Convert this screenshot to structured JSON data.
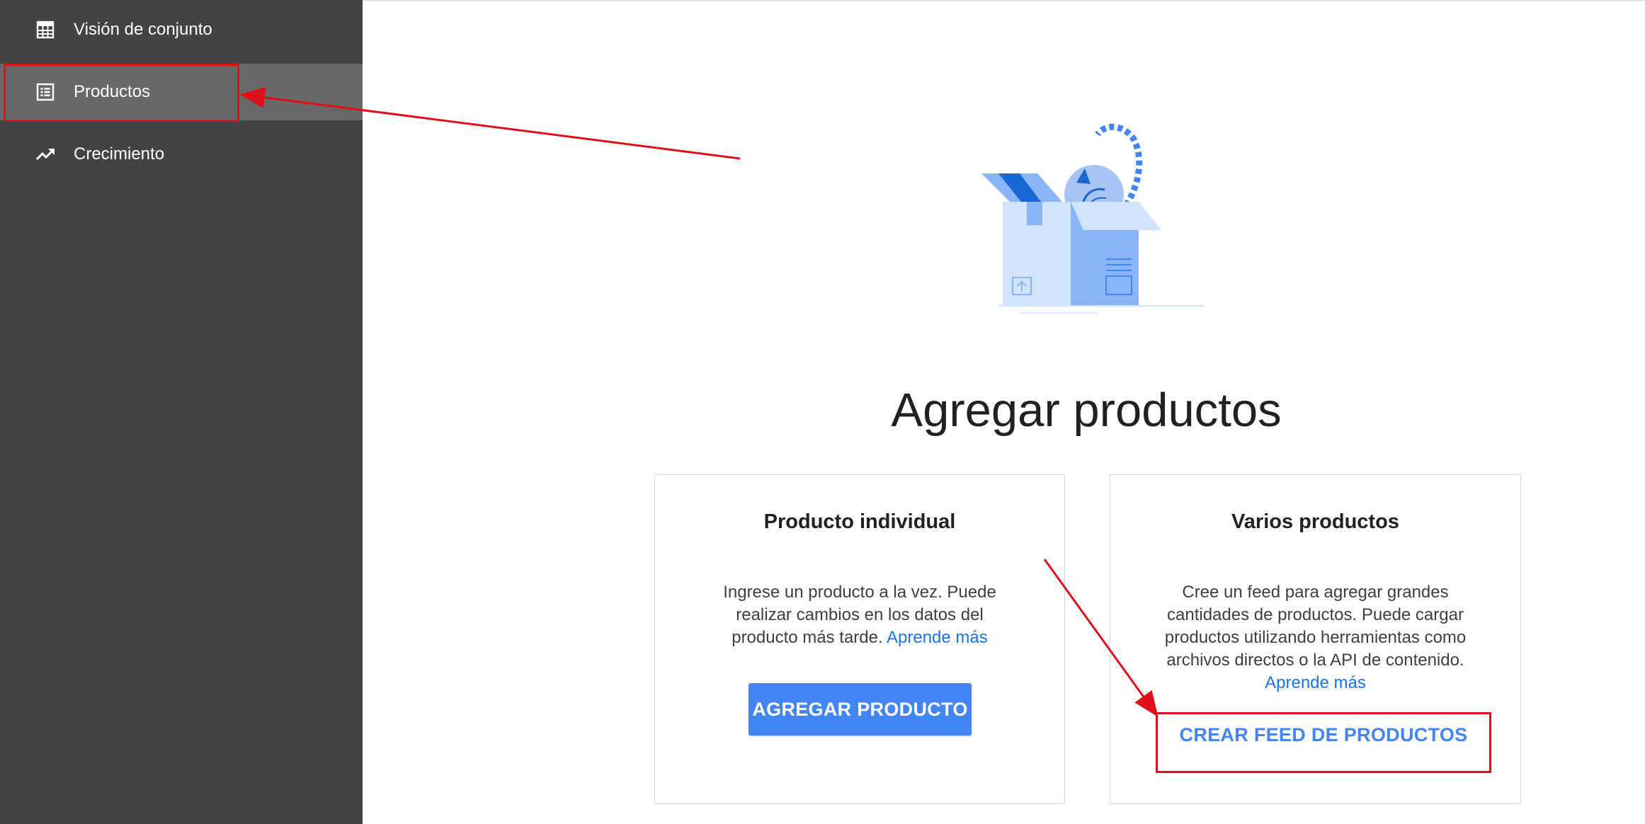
{
  "sidebar": {
    "items": [
      {
        "label": "Visión de conjunto",
        "icon": "calculator-grid-icon",
        "active": false
      },
      {
        "label": "Productos",
        "icon": "list-alt-icon",
        "active": true
      },
      {
        "label": "Crecimiento",
        "icon": "trending-up-icon",
        "active": false
      }
    ]
  },
  "main": {
    "title": "Agregar productos",
    "cards": {
      "individual": {
        "title": "Producto individual",
        "description": "Ingrese un producto a la vez. Puede realizar cambios en los datos del producto más tarde.",
        "link": "Aprende más",
        "button": "AGREGAR PRODUCTO"
      },
      "multiple": {
        "title": "Varios productos",
        "description": "Cree un feed para agregar grandes cantidades de productos. Puede cargar productos utilizando herramientas como archivos directos o la API de contenido.",
        "link": "Aprende más",
        "button": "CREAR FEED DE PRODUCTOS"
      }
    }
  },
  "colors": {
    "sidebar_bg": "#434343",
    "sidebar_active": "#686868",
    "primary": "#4285f4",
    "link": "#1a73e8",
    "annotation": "#e0101a"
  }
}
